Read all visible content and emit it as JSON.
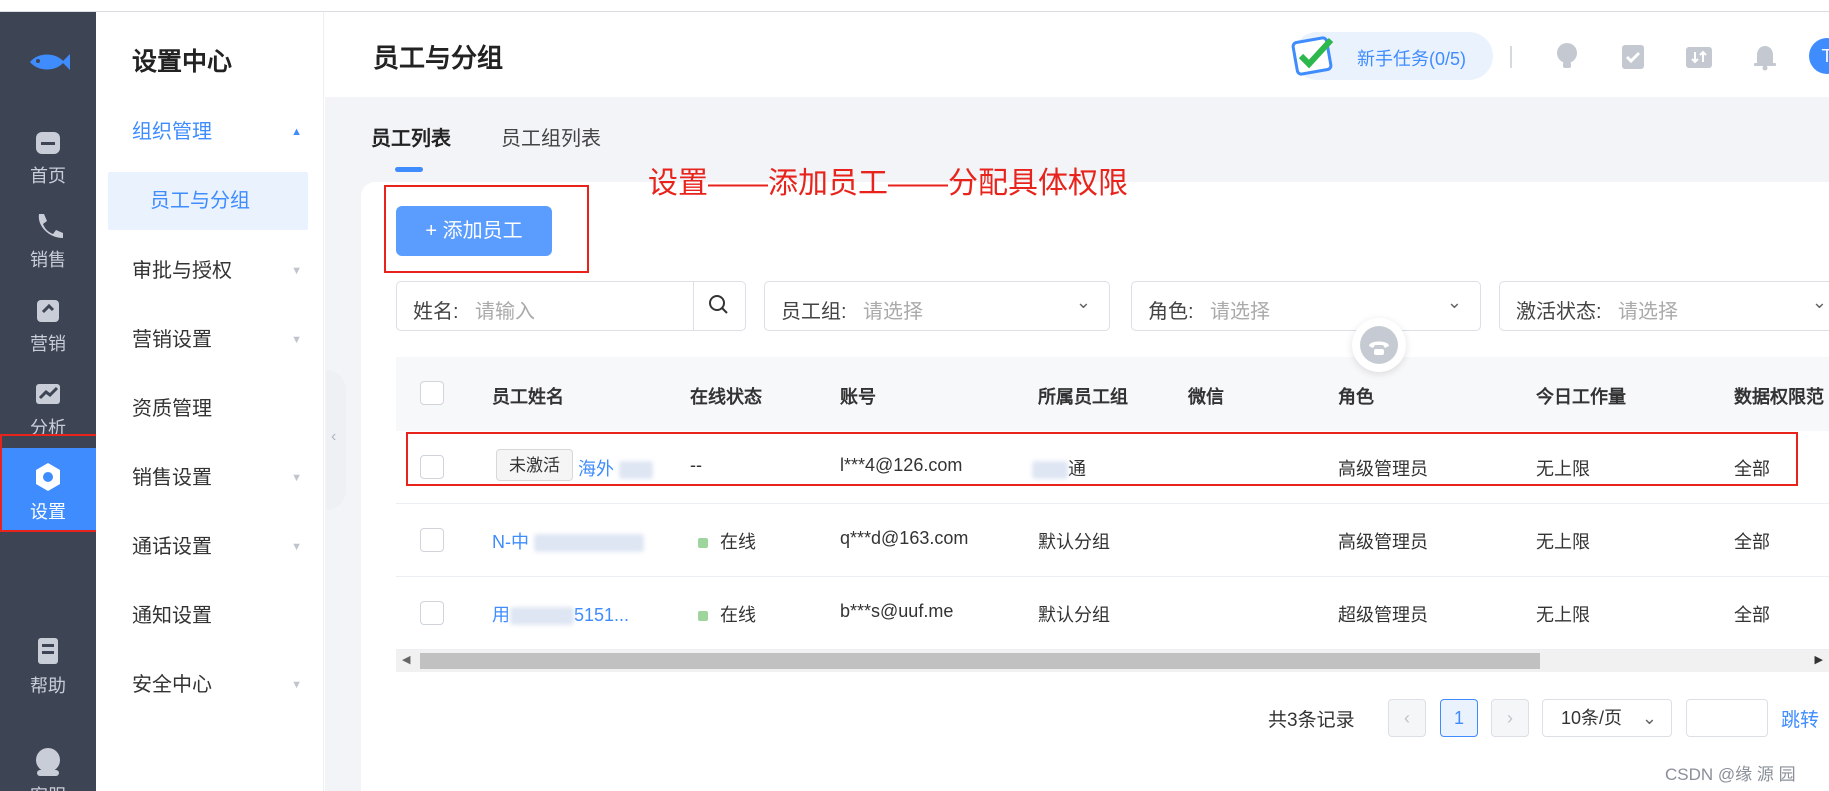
{
  "rail": {
    "items": [
      {
        "label": "首页",
        "icon": "home-icon"
      },
      {
        "label": "销售",
        "icon": "phone-icon"
      },
      {
        "label": "营销",
        "icon": "marketing-icon"
      },
      {
        "label": "分析",
        "icon": "analytics-icon"
      },
      {
        "label": "设置",
        "icon": "settings-icon",
        "active": true
      },
      {
        "label": "帮助",
        "icon": "help-icon"
      },
      {
        "label": "客服",
        "icon": "support-icon"
      }
    ]
  },
  "sidebar": {
    "title": "设置中心",
    "items": [
      {
        "label": "组织管理",
        "expanded": true
      },
      {
        "label": "员工与分组",
        "selected": true
      },
      {
        "label": "审批与授权"
      },
      {
        "label": "营销设置"
      },
      {
        "label": "资质管理"
      },
      {
        "label": "销售设置"
      },
      {
        "label": "通话设置"
      },
      {
        "label": "通知设置"
      },
      {
        "label": "安全中心"
      }
    ]
  },
  "header": {
    "title": "员工与分组",
    "task_label": "新手任务(0/5)",
    "avatar_letter": "T"
  },
  "tabs": [
    "员工列表",
    "员工组列表"
  ],
  "annotation": "设置——添加员工——分配具体权限",
  "add_button": "+ 添加员工",
  "filters": {
    "name_label": "姓名:",
    "name_placeholder": "请输入",
    "group_label": "员工组:",
    "group_placeholder": "请选择",
    "role_label": "角色:",
    "role_placeholder": "请选择",
    "status_label": "激活状态:",
    "status_placeholder": "请选择"
  },
  "table": {
    "columns": [
      "员工姓名",
      "在线状态",
      "账号",
      "所属员工组",
      "微信",
      "角色",
      "今日工作量",
      "数据权限范"
    ],
    "rows": [
      {
        "tag": "未激活",
        "name": "海外",
        "status": "--",
        "account": "l***4@126.com",
        "group": "通",
        "role": "高级管理员",
        "workload": "无上限",
        "scope": "全部"
      },
      {
        "name": "N-中",
        "status": "在线",
        "account": "q***d@163.com",
        "group": "默认分组",
        "role": "高级管理员",
        "workload": "无上限",
        "scope": "全部"
      },
      {
        "name": "用",
        "name_tail": "5151...",
        "status": "在线",
        "account": "b***s@uuf.me",
        "group": "默认分组",
        "role": "超级管理员",
        "workload": "无上限",
        "scope": "全部"
      }
    ]
  },
  "pagination": {
    "total": "共3条记录",
    "current_page": "1",
    "page_size": "10条/页",
    "jump": "跳转"
  },
  "watermark": "CSDN @缘 源 园",
  "colors": {
    "accent": "#3f8cff",
    "annotation": "#e8231c",
    "rail": "#3d4454"
  }
}
